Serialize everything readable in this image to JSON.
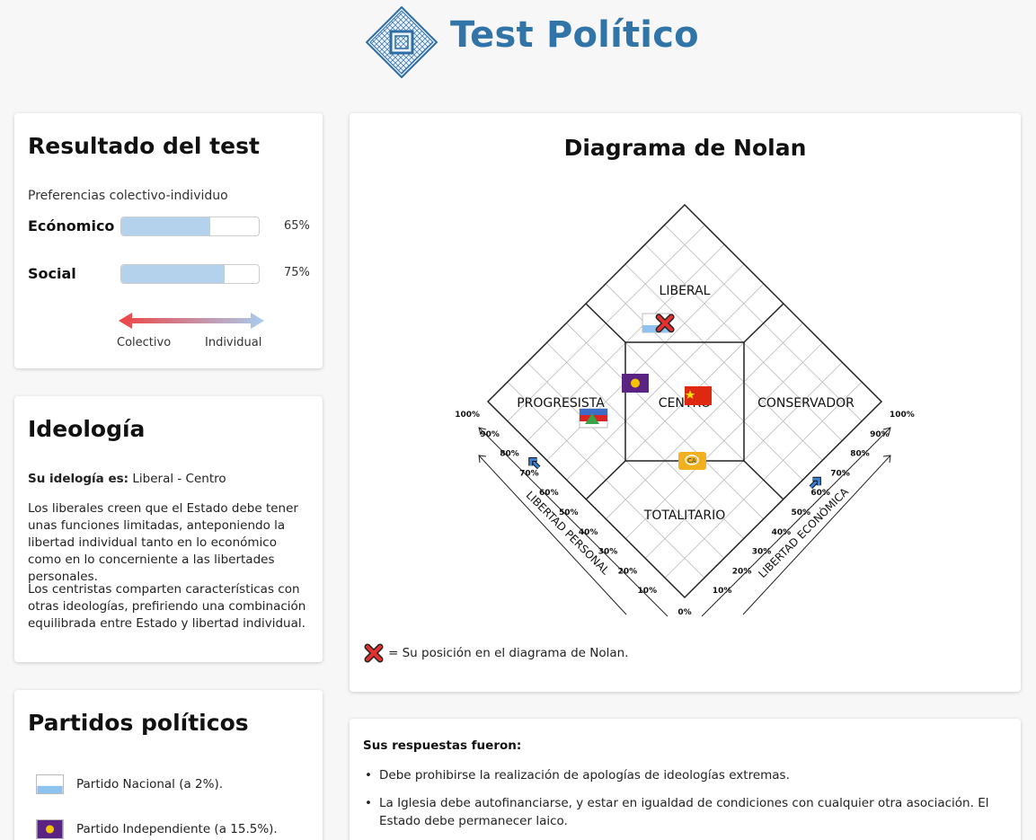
{
  "site": {
    "title": "Test Político"
  },
  "result": {
    "title": "Resultado del test",
    "preferences_label": "Preferencias colectivo-individuo",
    "economic": {
      "label": "Ecónomico",
      "value": 0.65,
      "pct_text": "65%"
    },
    "social": {
      "label": "Social",
      "value": 0.75,
      "pct_text": "75%"
    },
    "arrow": {
      "left_label": "Colectivo",
      "right_label": "Individual",
      "left_color": "#ee4444",
      "right_color": "#a8cdf0"
    }
  },
  "ideology": {
    "title": "Ideología",
    "your_ideology_label": "Su idelogía es:",
    "your_ideology_value": " Liberal - Centro",
    "paragraphs": [
      "Los liberales creen que el Estado debe tener unas funciones limitadas, anteponiendo la libertad individual tanto en lo económico como en lo concerniente a las libertades personales.",
      "Los centristas comparten características con otras ideologías, prefiriendo una combinación equilibrada entre Estado y libertad individual."
    ]
  },
  "parties": {
    "title": "Partidos políticos",
    "items": [
      {
        "name": "Partido Nacional (a 2%).",
        "flag": "partido-nacional-flag"
      },
      {
        "name": "Partido Independiente (a 15.5%).",
        "flag": "partido-independiente-flag"
      }
    ]
  },
  "nolan": {
    "title": "Diagrama de Nolan",
    "regions": {
      "liberal": "LIBERAL",
      "progresista": "PROGRESISTA",
      "centro": "CENTRO",
      "conservador": "CONSERVADOR",
      "totalitario": "TOTALITARIO"
    },
    "axis_left": "LIBERTAD PERSONAL",
    "axis_right": "LIBERTAD ECONÓMICA",
    "ticks_left": [
      "100%",
      "90%",
      "80%",
      "70%",
      "60%",
      "50%",
      "40%",
      "30%",
      "20%",
      "10%"
    ],
    "ticks_right": [
      "100%",
      "90%",
      "80%",
      "70%",
      "60%",
      "50%",
      "40%",
      "30%",
      "20%",
      "10%"
    ],
    "tick_origin": "0%",
    "user_position": {
      "personal": 0.75,
      "economic": 0.65
    },
    "legend_text": "= Su posición en el diagrama de Nolan.",
    "marker_icon": "red-x-icon",
    "colors": {
      "grid": "#bbbbbb",
      "border": "#222222",
      "marker": "#dd2222",
      "axis_arrow": "#3a7fd0"
    }
  },
  "answers": {
    "title": "Sus respuestas fueron:",
    "items": [
      "Debe prohibirse la realización de apologías de ideologías extremas.",
      "La Iglesia debe autofinanciarse, y estar en igualdad de condiciones con cualquier otra asociación. El Estado debe permanecer laico."
    ]
  }
}
